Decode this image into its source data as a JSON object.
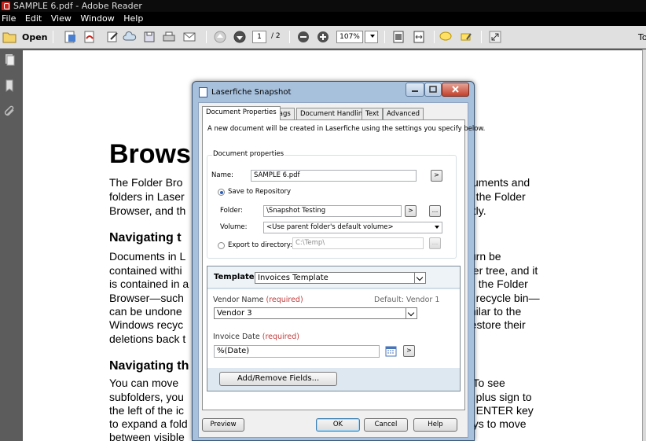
{
  "window": {
    "title": "SAMPLE 6.pdf - Adobe Reader"
  },
  "menu": [
    "File",
    "Edit",
    "View",
    "Window",
    "Help"
  ],
  "toolbar": {
    "open_label": "Open",
    "page_current": "1",
    "page_total": "/ 2",
    "zoom": "107%",
    "tools_label": "To"
  },
  "document": {
    "heading": "Brows",
    "para1": [
      "The Folder Bro",
      "folders in Laser",
      "Browser, and th"
    ],
    "para1_right": [
      "cuments and",
      "n the Folder",
      "ntly."
    ],
    "heading2": "Navigating t",
    "para2": [
      "Documents in L",
      "contained withi",
      "is contained in a",
      "Browser—such",
      "can be undone",
      "Windows recyc",
      "deletions back t"
    ],
    "para2_right": [
      "turn be",
      "der tree, and it",
      "in the Folder",
      "e recycle bin—",
      "milar to the",
      "restore their"
    ],
    "heading3": "Navigating th",
    "para3": [
      "You can move",
      "subfolders, you",
      "the left of the ic",
      "to expand a fold",
      "between visible"
    ],
    "para3_right": [
      ". To see",
      "e plus sign to",
      "e ENTER key",
      "eys to move"
    ]
  },
  "dialog": {
    "title": "Laserfiche Snapshot",
    "tabs": [
      "Document Properties",
      "Tags",
      "Document Handling",
      "Text",
      "Advanced"
    ],
    "intro": "A new document will be created in Laserfiche using the settings you specify below.",
    "group_label": "Document properties",
    "name_label": "Name:",
    "name_value": "SAMPLE 6.pdf",
    "save_to_repository": "Save to Repository",
    "folder_label": "Folder:",
    "folder_value": "\\Snapshot Testing",
    "volume_label": "Volume:",
    "volume_value": "<Use parent folder's default volume>",
    "export_label": "Export to directory:",
    "export_value": "C:\\Temp\\",
    "arrow_glyph": ">",
    "ellipsis_glyph": "...",
    "template": {
      "label": "Template:",
      "value": "Invoices Template",
      "vendor_label": "Vendor Name",
      "required": "(required)",
      "vendor_default": "Default: Vendor 1",
      "vendor_value": "Vendor 3",
      "invoice_label": "Invoice Date",
      "invoice_value": "%(Date)",
      "add_remove": "Add/Remove Fields..."
    },
    "buttons": {
      "preview": "Preview",
      "ok": "OK",
      "cancel": "Cancel",
      "help": "Help"
    }
  },
  "colors": {
    "accent": "#2b60b8",
    "required": "#c23a3a",
    "dialog_frame": "#a7c0dc"
  }
}
